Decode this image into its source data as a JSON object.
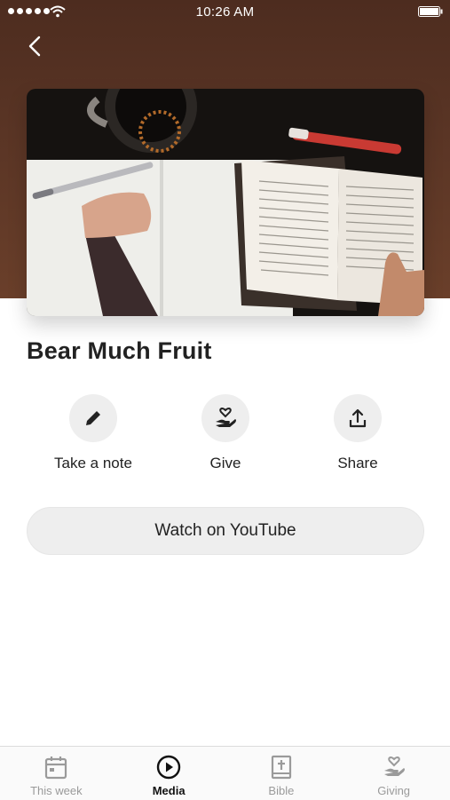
{
  "status_bar": {
    "time": "10:26 AM"
  },
  "media": {
    "title": "Bear Much Fruit"
  },
  "actions": [
    {
      "label": "Take a note",
      "icon": "pencil-icon"
    },
    {
      "label": "Give",
      "icon": "heart-hand-icon"
    },
    {
      "label": "Share",
      "icon": "share-icon"
    }
  ],
  "watch_button": {
    "label": "Watch on YouTube"
  },
  "tabs": [
    {
      "label": "This week",
      "icon": "calendar-icon",
      "active": false
    },
    {
      "label": "Media",
      "icon": "play-circle-icon",
      "active": true
    },
    {
      "label": "Bible",
      "icon": "bible-icon",
      "active": false
    },
    {
      "label": "Giving",
      "icon": "heart-hand-icon",
      "active": false
    }
  ],
  "colors": {
    "header_bg": "#5a3525",
    "action_circle": "#eeeeee",
    "tab_active": "#111111",
    "tab_inactive": "#9a9a9a"
  }
}
